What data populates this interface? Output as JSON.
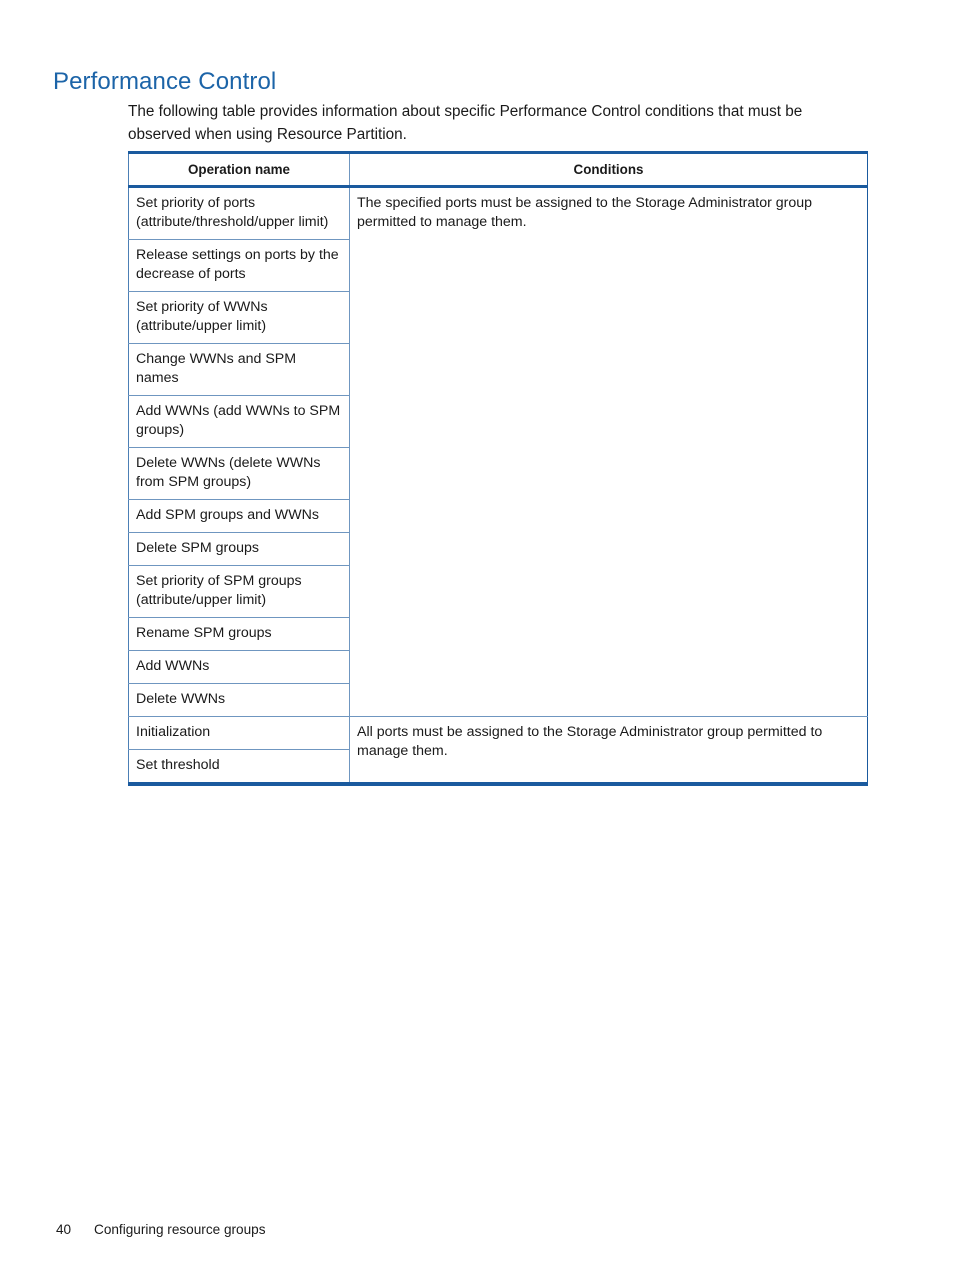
{
  "document": {
    "heading": "Performance Control",
    "intro_paragraph": "The following table provides information about specific Performance Control conditions that must be observed when using Resource Partition.",
    "accent_color": "#1c64a8",
    "table_border_dark": "#1a5a9e",
    "table_border_light": "#6f96c0"
  },
  "table": {
    "headers": {
      "col1": "Operation name",
      "col2": "Conditions"
    },
    "groups": [
      {
        "condition": "The specified ports must be assigned to the Storage Administrator group permitted to manage them.",
        "operations": [
          "Set priority of ports (attribute/threshold/upper limit)",
          "Release settings on ports by the decrease of ports",
          "Set priority of WWNs (attribute/upper limit)",
          "Change WWNs and SPM names",
          "Add WWNs (add WWNs to SPM groups)",
          "Delete WWNs (delete WWNs from SPM groups)",
          "Add SPM groups and WWNs",
          "Delete SPM groups",
          "Set priority of SPM groups (attribute/upper limit)",
          "Rename SPM groups",
          "Add WWNs",
          "Delete WWNs"
        ]
      },
      {
        "condition": "All ports must be assigned to the Storage Administrator group permitted to manage them.",
        "operations": [
          "Initialization",
          "Set threshold"
        ]
      }
    ]
  },
  "footer": {
    "page_number": "40",
    "chapter_label": "Configuring resource groups"
  }
}
